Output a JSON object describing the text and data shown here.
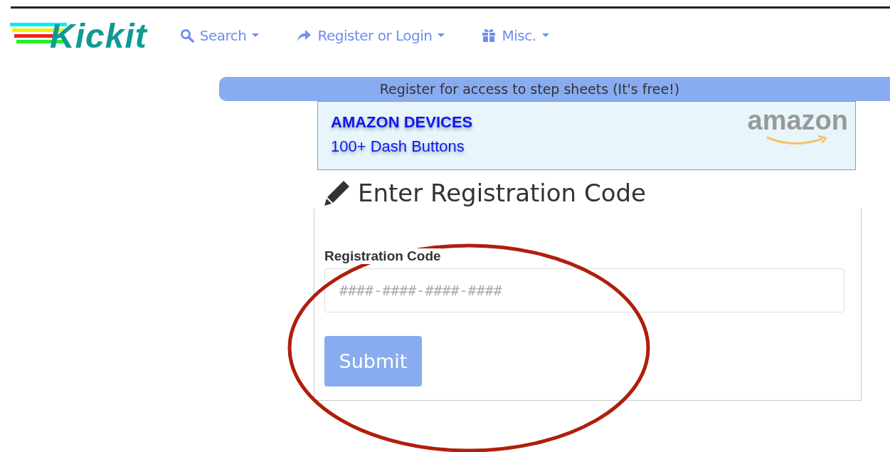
{
  "logo": {
    "text": "Kickit"
  },
  "nav": [
    {
      "label": "Search"
    },
    {
      "label": "Register or Login"
    },
    {
      "label": "Misc."
    }
  ],
  "banner": {
    "text": "Register for access to step sheets (It's free!)"
  },
  "ad": {
    "title": "AMAZON DEVICES",
    "subtitle": "100+ Dash Buttons",
    "brand": "amazon"
  },
  "form": {
    "heading": "Enter Registration Code",
    "field_label": "Registration Code",
    "placeholder": "####-####-####-####",
    "submit": {
      "label": "Submit",
      "disabled": true
    }
  },
  "annotation": {
    "kind": "ellipse"
  }
}
